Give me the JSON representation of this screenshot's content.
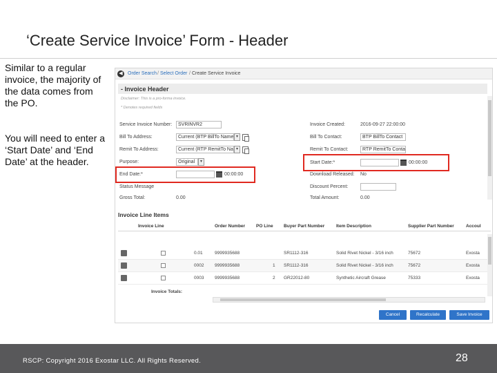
{
  "slide": {
    "title": "‘Create Service Invoice’ Form - Header",
    "side_text_1": "Similar to a regular invoice, the majority of the data comes from the PO.",
    "side_text_2": "You will need to enter a ‘Start Date’ and ‘End Date’ at the header.",
    "footer": "RSCP: Copyright 2016 Exostar LLC. All Rights Reserved.",
    "page_number": "28"
  },
  "breadcrumb": {
    "item1": "Order Search",
    "item2": "Select Order",
    "item3": "Create Service Invoice",
    "separator": "/"
  },
  "invoice_header": {
    "title": "- Invoice Header",
    "disclaimer": "Disclaimer: This is a pro-forma invoice.",
    "required_note": "* Denotes required fields",
    "left_fields": [
      {
        "label": "Service Invoice Number:",
        "value": "SVRINVR2"
      },
      {
        "label": "Bill To Address:",
        "value": "Current (BTP BillTo Name)"
      },
      {
        "label": "Remit To Address:",
        "value": "Current (RTP RemitTo Name)"
      },
      {
        "label": "Purpose:",
        "value": "Original"
      },
      {
        "label": "End Date:*",
        "value": "",
        "time": "00:00:00"
      },
      {
        "label": "Status Message",
        "value": ""
      },
      {
        "label": "Gross Total:",
        "value": "0.00"
      }
    ],
    "right_fields": [
      {
        "label": "Invoice Created:",
        "value": "2016-09-27 22:00:00"
      },
      {
        "label": "Bill To Contact:",
        "value": "BTP BillTo Contact"
      },
      {
        "label": "Remit To Contact:",
        "value": "RTP RemitTo Conta"
      },
      {
        "label": "Start Date:*",
        "value": "",
        "time": "00:00:00"
      },
      {
        "label": "Download Released:",
        "value": "No"
      },
      {
        "label": "Discount Percent:",
        "value": ""
      },
      {
        "label": "Total Amount:",
        "value": "0.00"
      }
    ]
  },
  "line_items": {
    "title": "Invoice Line Items",
    "columns": [
      "Invoice Line",
      "Order Number",
      "PO Line",
      "Buyer Part Number",
      "Item Description",
      "Supplier Part Number",
      "Accoul"
    ],
    "rows": [
      {
        "line": "0.01",
        "order": "9999935688",
        "po_line": "",
        "buyer_part": "SR1112-316",
        "desc": "Solid Rivet Nickel - 3/16 inch",
        "supplier_part": "75672",
        "acct": "Exosta"
      },
      {
        "line": "0002",
        "order": "9999935688",
        "po_line": "1",
        "buyer_part": "SR1112-316",
        "desc": "Solid Rivet Nickel - 3/16 inch",
        "supplier_part": "75672",
        "acct": "Exosta"
      },
      {
        "line": "0003",
        "order": "9999935688",
        "po_line": "2",
        "buyer_part": "GR22012-80",
        "desc": "Synthetic Aircraft Grease",
        "supplier_part": "75333",
        "acct": "Exosta"
      }
    ],
    "totals_label": "Invoice Totals:"
  },
  "buttons": {
    "cancel": "Cancel",
    "recalculate": "Recalculate",
    "save": "Save Invoice"
  },
  "colors": {
    "highlight": "#e0281f",
    "button": "#2f74c9",
    "footer_bar": "#58585a"
  }
}
